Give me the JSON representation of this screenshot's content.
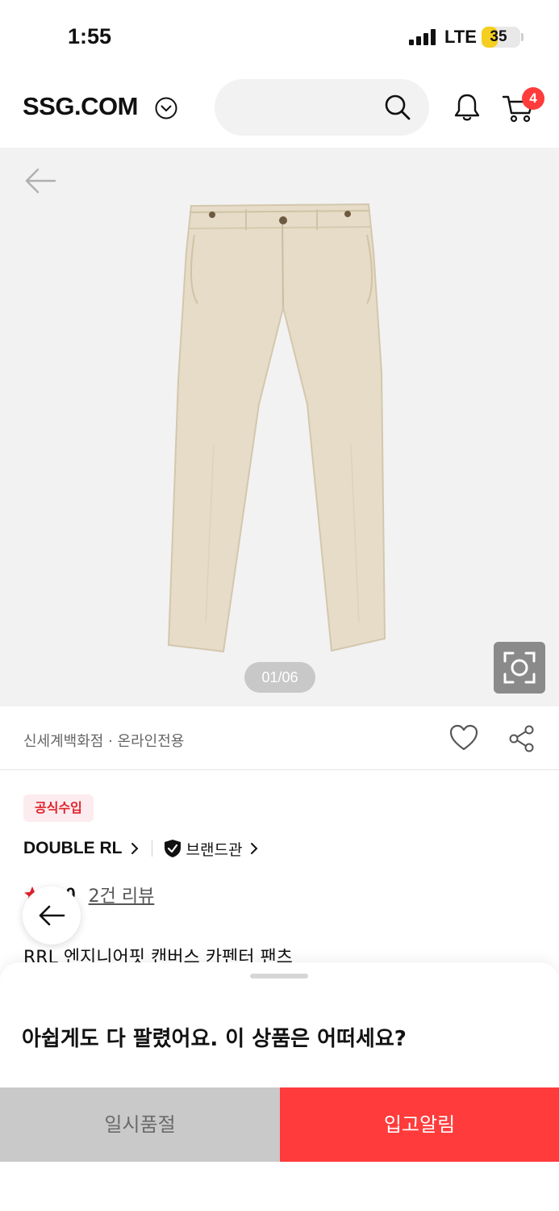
{
  "status_bar": {
    "time": "1:55",
    "network": "LTE",
    "battery": "35",
    "battery_level_percent": 35,
    "battery_color": "#f4cf1f"
  },
  "header": {
    "logo": "SSG.COM",
    "icons": [
      "chevron-down-icon",
      "search-icon",
      "bell-icon",
      "cart-icon"
    ],
    "cart_count": "4",
    "badge_color": "#ff3b3b"
  },
  "product_image": {
    "counter": "01/06",
    "icons": [
      "back-arrow-icon",
      "lens-search-icon"
    ]
  },
  "store": {
    "text": "신세계백화점 · 온라인전용",
    "icons": [
      "heart-icon",
      "share-icon"
    ]
  },
  "product": {
    "official_badge": "공식수입",
    "brand": "DOUBLE RL",
    "brand_shop": "브랜드관",
    "rating": "5.0",
    "reviews": "2건 리뷰",
    "title": "RRL 엔지니어핏 캔버스 카펜터 팬츠",
    "star_color": "#e1222b"
  },
  "sheet": {
    "title": "아쉽게도 다 팔렸어요. 이 상품은 어떠세요?",
    "soldout_label": "일시품절",
    "restock_label": "입고알림",
    "accent": "#ff3b3b"
  }
}
